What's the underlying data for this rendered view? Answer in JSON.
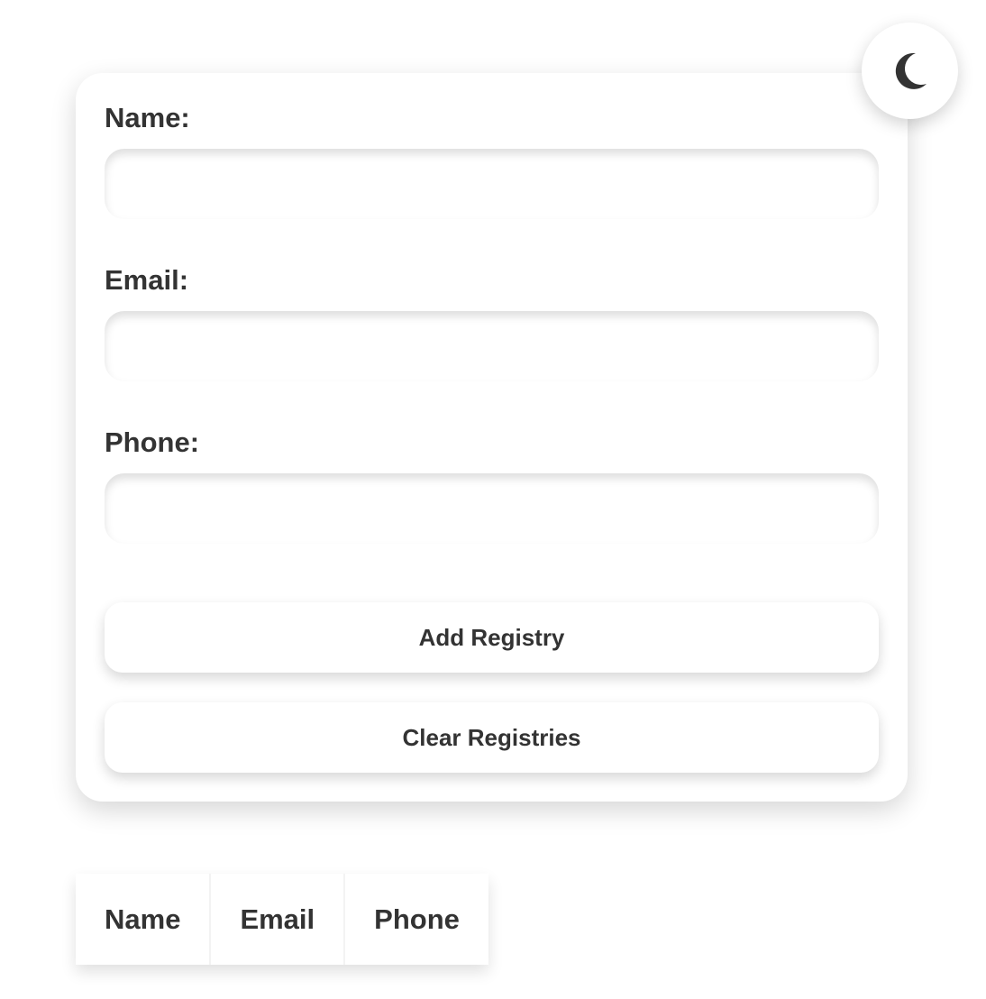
{
  "theme_toggle": {
    "icon": "moon-icon",
    "icon_color": "#333333"
  },
  "form": {
    "fields": [
      {
        "label": "Name:",
        "value": "",
        "placeholder": ""
      },
      {
        "label": "Email:",
        "value": "",
        "placeholder": ""
      },
      {
        "label": "Phone:",
        "value": "",
        "placeholder": ""
      }
    ],
    "add_label": "Add Registry",
    "clear_label": "Clear Registries"
  },
  "table": {
    "headers": [
      "Name",
      "Email",
      "Phone"
    ],
    "rows": []
  },
  "colors": {
    "background": "#ffffff",
    "text": "#333333"
  }
}
